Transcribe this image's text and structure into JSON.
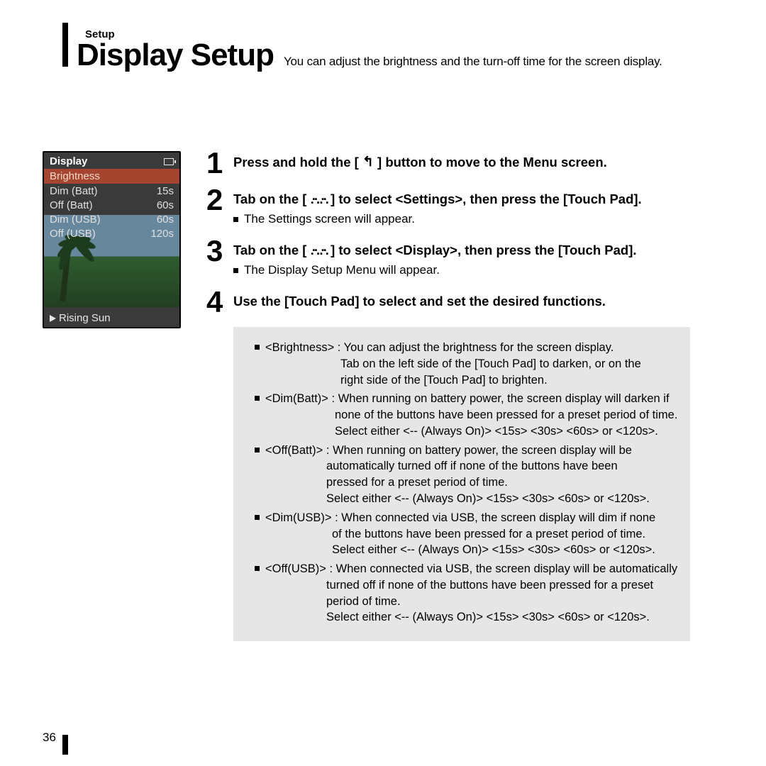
{
  "breadcrumb": "Setup",
  "title": "Display Setup",
  "subtitle": "You can adjust the brightness and the turn-off time for the screen display.",
  "device": {
    "header": "Display",
    "selected": "Brightness",
    "rows": [
      {
        "label": "Dim (Batt)",
        "value": "15s"
      },
      {
        "label": "Off (Batt)",
        "value": "60s"
      },
      {
        "label": "Dim (USB)",
        "value": "60s"
      },
      {
        "label": "Off (USB)",
        "value": "120s"
      }
    ],
    "now_playing": "Rising Sun"
  },
  "steps": {
    "s1": {
      "num": "1",
      "pre": "Press and hold the [ ",
      "post": " ] button to move to the Menu screen.",
      "icon": "↰"
    },
    "s2": {
      "num": "2",
      "pre": "Tab on the [ ",
      "post": " ] to select <Settings>, then press the [Touch Pad].",
      "icon": ".··. .··.",
      "sub": "The Settings screen will appear."
    },
    "s3": {
      "num": "3",
      "pre": "Tab on the [ ",
      "post": " ] to select <Display>, then press the [Touch Pad].",
      "icon": ".··. .··.",
      "sub": "The Display Setup Menu will appear."
    },
    "s4": {
      "num": "4",
      "text": "Use the [Touch Pad] to select and set the desired functions."
    }
  },
  "options": {
    "brightness": {
      "first": "<Brightness> : You can adjust the brightness for the screen display.",
      "rest1": "Tab on the left side of the [Touch Pad] to darken, or on the",
      "rest2": "right side of the [Touch Pad] to brighten."
    },
    "dimbatt": {
      "first": "<Dim(Batt)> : When running on battery power, the screen display will darken if",
      "rest1": "none of the buttons have been pressed for a preset period of time.",
      "rest2": "Select either <-- (Always On)> <15s> <30s> <60s> or <120s>."
    },
    "offbatt": {
      "first": "<Off(Batt)> : When running on battery power, the screen display will be",
      "rest1": "automatically turned off if none of the buttons have been",
      "rest2": "pressed for a preset period of time.",
      "rest3": "Select either <-- (Always On)> <15s> <30s> <60s> or <120s>."
    },
    "dimusb": {
      "first": "<Dim(USB)> : When connected via USB, the screen display will dim if none",
      "rest1": "of the buttons have been pressed for a preset period of time.",
      "rest2": "Select either <-- (Always On)> <15s> <30s> <60s> or <120s>."
    },
    "offusb": {
      "first": "<Off(USB)> : When connected via USB, the screen display will be automatically",
      "rest1": "turned off if none of the buttons have been pressed for a preset",
      "rest2": "period of time.",
      "rest3": "Select either <-- (Always On)> <15s> <30s> <60s> or <120s>."
    }
  },
  "page_number": "36"
}
